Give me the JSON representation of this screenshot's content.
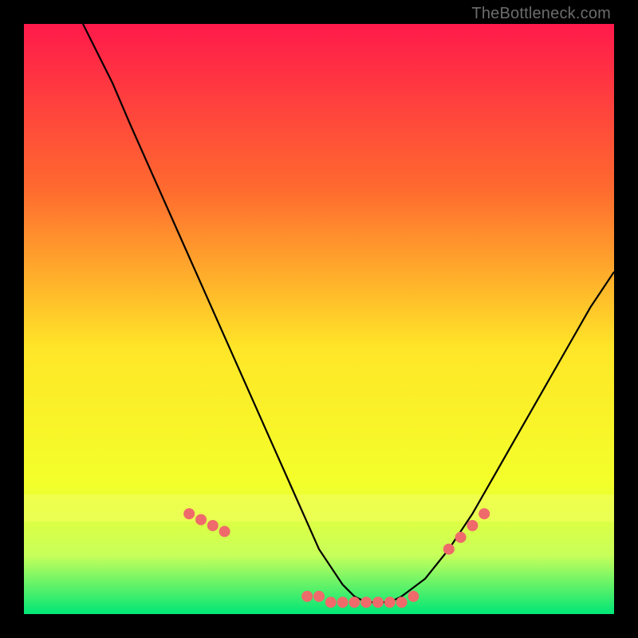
{
  "watermark": "TheBottleneck.com",
  "chart_data": {
    "type": "line",
    "title": "",
    "xlabel": "",
    "ylabel": "",
    "xlim": [
      0,
      100
    ],
    "ylim": [
      0,
      100
    ],
    "grid": false,
    "legend": false,
    "gradient_colors": {
      "top": "#ff1a4b",
      "upper_mid": "#ff8a2a",
      "mid": "#ffe628",
      "lower_mid": "#f3ff2a",
      "low": "#c8ff5a",
      "bottom": "#00e676"
    },
    "series": [
      {
        "name": "bottleneck-curve",
        "color": "#000000",
        "x": [
          10,
          12,
          15,
          18,
          22,
          26,
          30,
          34,
          38,
          42,
          46,
          50,
          52,
          54,
          56,
          58,
          60,
          62,
          64,
          68,
          72,
          76,
          80,
          84,
          88,
          92,
          96,
          100
        ],
        "y": [
          100,
          96,
          90,
          83,
          74,
          65,
          56,
          47,
          38,
          29,
          20,
          11,
          8,
          5,
          3,
          2,
          2,
          2,
          3,
          6,
          11,
          17,
          24,
          31,
          38,
          45,
          52,
          58
        ]
      }
    ],
    "highlight_points": {
      "name": "highlight-dots",
      "color": "#ef6a6a",
      "radius": 7,
      "x": [
        28,
        30,
        32,
        34,
        48,
        50,
        52,
        54,
        56,
        58,
        60,
        62,
        64,
        66,
        72,
        74,
        76,
        78
      ],
      "y": [
        17,
        16,
        15,
        14,
        3,
        3,
        2,
        2,
        2,
        2,
        2,
        2,
        2,
        3,
        11,
        13,
        15,
        17
      ]
    }
  }
}
